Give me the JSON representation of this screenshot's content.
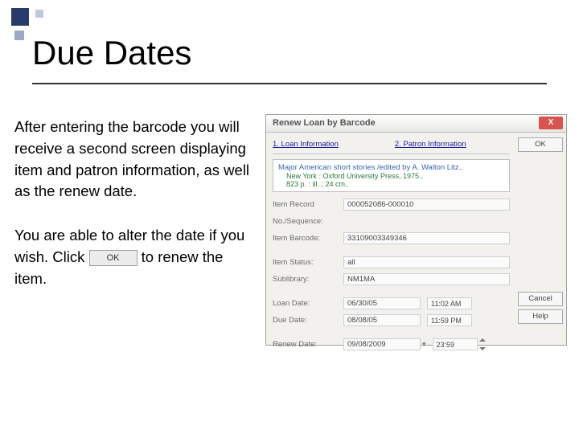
{
  "slide": {
    "title": "Due Dates",
    "para1": "After entering the barcode you will receive a second screen displaying item and patron information, as well as the renew date.",
    "para2a": "You are able to alter the date if you wish.  Click ",
    "para2b": " to renew the item.",
    "inline_ok": "OK"
  },
  "dialog": {
    "title": "Renew Loan by Barcode",
    "close": "X",
    "tabs": {
      "t1": "1. Loan Information",
      "t2": "2. Patron Information"
    },
    "desc": {
      "line1": "Major American short stories /edited by A. Walton Litz..",
      "line2": "New York : Oxford University Press, 1975..",
      "line3": "823 p. : ill. ; 24 cm.."
    },
    "labels": {
      "item_record": "Item Record",
      "no_seq": "No./Sequence:",
      "barcode": "Item Barcode:",
      "status": "Item Status:",
      "sublib": "Sublibrary:",
      "loan_date": "Loan Date:",
      "due_date": "Due Date:",
      "renew_date": "Renew Date:"
    },
    "values": {
      "item_record": "000052086-000010",
      "barcode": "33109003349346",
      "status": "all",
      "sublib": "NM1MA",
      "loan_date": "06/30/05",
      "loan_time": "11:02 AM",
      "due_date": "08/08/05",
      "due_time": "11:59 PM",
      "renew_date": "09/08/2009",
      "renew_time": "23:59"
    },
    "buttons": {
      "ok": "OK",
      "cancel": "Cancel",
      "help": "Help"
    }
  }
}
